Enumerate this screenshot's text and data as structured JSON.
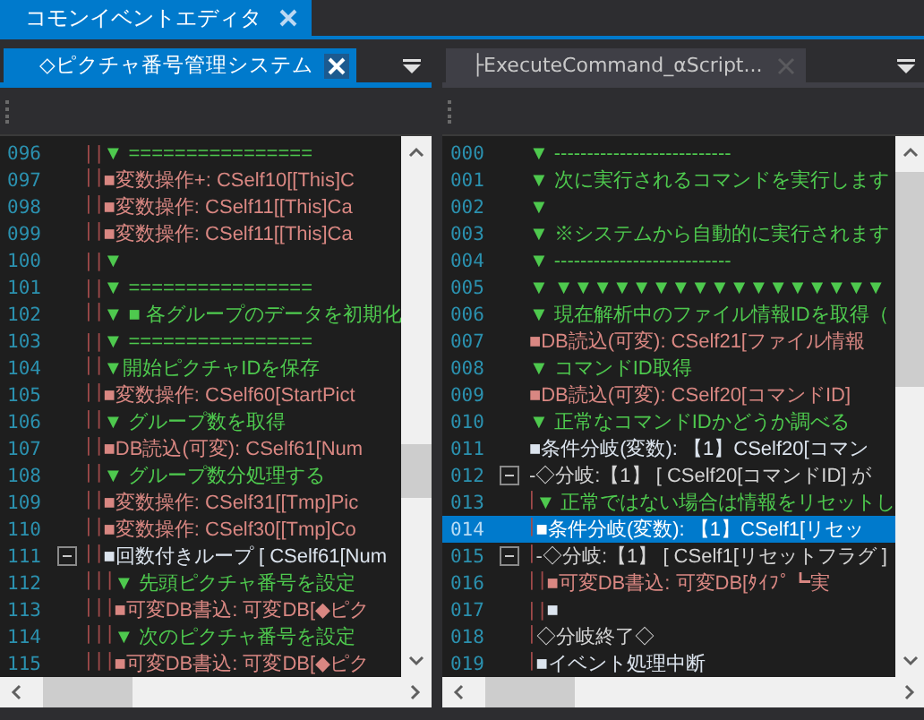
{
  "editor": {
    "title": "コモンイベントエディタ"
  },
  "panes": [
    {
      "tab": {
        "title": "◇ピクチャ番号管理システム",
        "active": true
      },
      "lines": [
        {
          "number": "096",
          "guides": "| |",
          "kind": "comment",
          "text": "▼ ================",
          "foldable": false,
          "selected": false
        },
        {
          "number": "097",
          "guides": "| |",
          "kind": "command",
          "text": "■変数操作+: CSelf10[[This]C",
          "foldable": false,
          "selected": false
        },
        {
          "number": "098",
          "guides": "| |",
          "kind": "command",
          "text": "■変数操作: CSelf11[[This]Ca",
          "foldable": false,
          "selected": false
        },
        {
          "number": "099",
          "guides": "| |",
          "kind": "command",
          "text": "■変数操作: CSelf11[[This]Ca",
          "foldable": false,
          "selected": false
        },
        {
          "number": "100",
          "guides": "| |",
          "kind": "comment",
          "text": "▼",
          "foldable": false,
          "selected": false
        },
        {
          "number": "101",
          "guides": "| |",
          "kind": "comment",
          "text": "▼ ================",
          "foldable": false,
          "selected": false
        },
        {
          "number": "102",
          "guides": "| |",
          "kind": "comment",
          "text": "▼ ■ 各グループのデータを初期化",
          "foldable": false,
          "selected": false
        },
        {
          "number": "103",
          "guides": "| |",
          "kind": "comment",
          "text": "▼ ================",
          "foldable": false,
          "selected": false
        },
        {
          "number": "104",
          "guides": "| |",
          "kind": "comment",
          "text": "▼開始ピクチャIDを保存",
          "foldable": false,
          "selected": false
        },
        {
          "number": "105",
          "guides": "| |",
          "kind": "command",
          "text": "■変数操作: CSelf60[StartPict",
          "foldable": false,
          "selected": false
        },
        {
          "number": "106",
          "guides": "| |",
          "kind": "comment",
          "text": "▼ グループ数を取得",
          "foldable": false,
          "selected": false
        },
        {
          "number": "107",
          "guides": "| |",
          "kind": "command",
          "text": "■DB読込(可変): CSelf61[Num",
          "foldable": false,
          "selected": false
        },
        {
          "number": "108",
          "guides": "| |",
          "kind": "comment",
          "text": "▼ グループ数分処理する",
          "foldable": false,
          "selected": false
        },
        {
          "number": "109",
          "guides": "| |",
          "kind": "command",
          "text": "■変数操作: CSelf31[[Tmp]Pic",
          "foldable": false,
          "selected": false
        },
        {
          "number": "110",
          "guides": "| |",
          "kind": "command",
          "text": "■変数操作: CSelf30[[Tmp]Co",
          "foldable": false,
          "selected": false
        },
        {
          "number": "111",
          "guides": "| |",
          "kind": "control",
          "text": "■回数付きループ [ CSelf61[Num",
          "foldable": true,
          "selected": false
        },
        {
          "number": "112",
          "guides": "| | |",
          "kind": "comment",
          "text": "▼ 先頭ピクチャ番号を設定",
          "foldable": false,
          "selected": false
        },
        {
          "number": "113",
          "guides": "| | |",
          "kind": "command",
          "text": "■可変DB書込: 可変DB[◆ピク",
          "foldable": false,
          "selected": false
        },
        {
          "number": "114",
          "guides": "| | |",
          "kind": "comment",
          "text": "▼ 次のピクチャ番号を設定",
          "foldable": false,
          "selected": false
        },
        {
          "number": "115",
          "guides": "| | |",
          "kind": "command",
          "text": "■可変DB書込: 可変DB[◆ピク",
          "foldable": false,
          "selected": false
        }
      ]
    },
    {
      "tab": {
        "title": "├ExecuteCommand_αScript...",
        "active": false
      },
      "lines": [
        {
          "number": "000",
          "kind": "comment",
          "text": "▼ ---------------------------",
          "foldable": false,
          "selected": false
        },
        {
          "number": "001",
          "kind": "comment",
          "text": "▼ 次に実行されるコマンドを実行します",
          "foldable": false,
          "selected": false
        },
        {
          "number": "002",
          "kind": "comment",
          "text": "▼",
          "foldable": false,
          "selected": false
        },
        {
          "number": "003",
          "kind": "comment",
          "text": "▼ ※システムから自動的に実行されます",
          "foldable": false,
          "selected": false
        },
        {
          "number": "004",
          "kind": "comment",
          "text": "▼ ---------------------------",
          "foldable": false,
          "selected": false
        },
        {
          "number": "005",
          "kind": "comment",
          "text": "▼ ▼▼▼▼▼▼▼▼▼▼▼▼▼▼▼▼▼",
          "foldable": false,
          "selected": false
        },
        {
          "number": "006",
          "kind": "comment",
          "text": "▼ 現在解析中のファイル情報IDを取得（",
          "foldable": false,
          "selected": false
        },
        {
          "number": "007",
          "kind": "command",
          "text": "■DB読込(可変): CSelf21[ファイル情報",
          "foldable": false,
          "selected": false
        },
        {
          "number": "008",
          "kind": "comment",
          "text": "▼ コマンドID取得",
          "foldable": false,
          "selected": false
        },
        {
          "number": "009",
          "kind": "command",
          "text": "■DB読込(可変): CSelf20[コマンドID]",
          "foldable": false,
          "selected": false
        },
        {
          "number": "010",
          "kind": "comment",
          "text": "▼ 正常なコマンドIDかどうか調べる",
          "foldable": false,
          "selected": false
        },
        {
          "number": "011",
          "kind": "control",
          "text": "■条件分岐(変数): 【1】CSelf20[コマン",
          "foldable": false,
          "selected": false
        },
        {
          "number": "012",
          "kind": "branch",
          "text": "-◇分岐:【1】 [ CSelf20[コマンドID] が",
          "foldable": true,
          "selected": false
        },
        {
          "number": "013",
          "guides": "|",
          "kind": "comment",
          "text": "▼ 正常ではない場合は情報をリセットし",
          "foldable": false,
          "selected": false
        },
        {
          "number": "014",
          "guides": "|",
          "kind": "control",
          "text": "■条件分岐(変数): 【1】CSelf1[リセッ",
          "foldable": false,
          "selected": true
        },
        {
          "number": "015",
          "guides": "|",
          "kind": "branch",
          "text": "-◇分岐:【1】 [ CSelf1[リセットフラグ ]",
          "foldable": true,
          "selected": false
        },
        {
          "number": "016",
          "guides": "| |",
          "kind": "command",
          "text": "■可変DB書込: 可変DB[ﾀｲﾌﾟ┗実",
          "foldable": false,
          "selected": false
        },
        {
          "number": "017",
          "guides": "| |",
          "kind": "control",
          "text": "■",
          "foldable": false,
          "selected": false
        },
        {
          "number": "018",
          "guides": "|",
          "kind": "branch",
          "text": "◇分岐終了◇",
          "foldable": false,
          "selected": false
        },
        {
          "number": "019",
          "guides": "|",
          "kind": "control",
          "text": "■イベント処理中断",
          "foldable": false,
          "selected": false
        }
      ]
    }
  ]
}
